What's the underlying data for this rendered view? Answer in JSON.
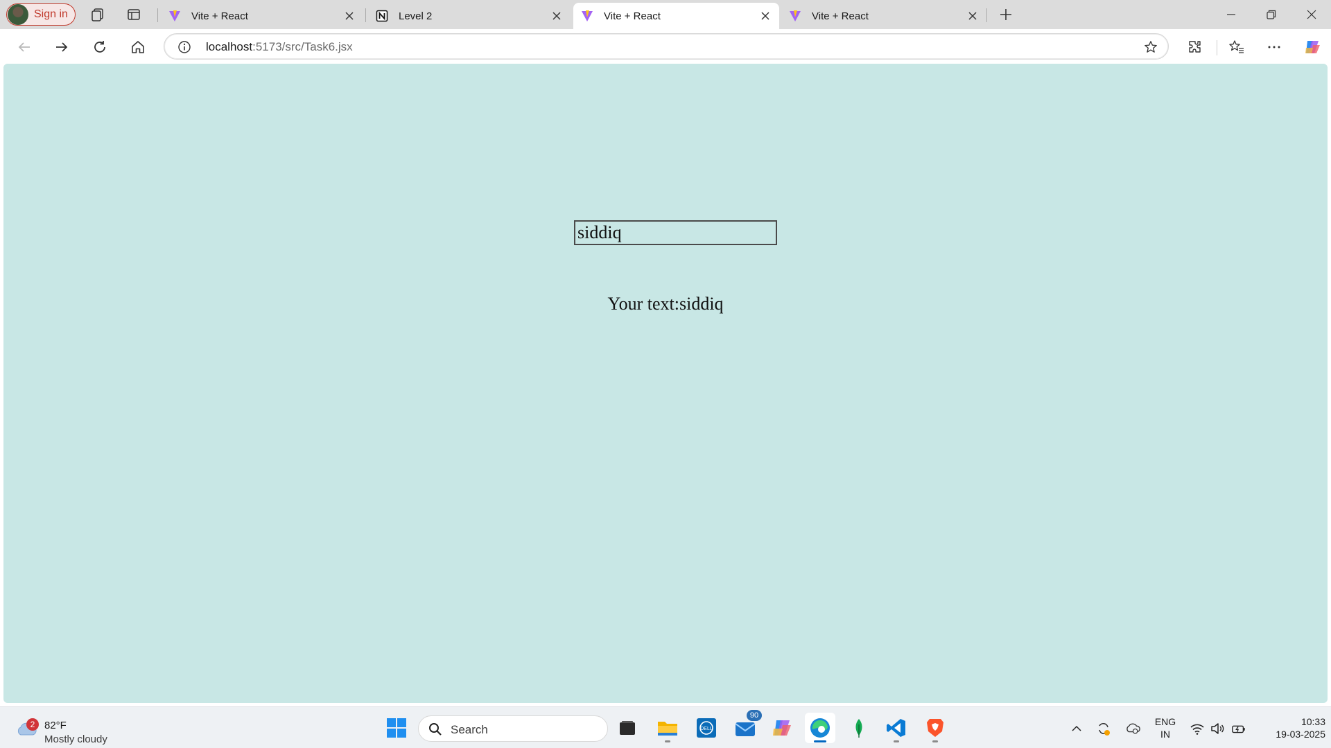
{
  "browser": {
    "signin_label": "Sign in",
    "tabs": [
      {
        "title": "Vite + React",
        "favicon": "vite-logo",
        "active": false
      },
      {
        "title": "Level 2",
        "favicon": "notion-logo",
        "active": false
      },
      {
        "title": "Vite + React",
        "favicon": "vite-logo",
        "active": true
      },
      {
        "title": "Vite + React",
        "favicon": "vite-logo",
        "active": false
      }
    ],
    "address": {
      "host": "localhost",
      "path": ":5173/src/Task6.jsx"
    }
  },
  "page": {
    "background": "#c8e7e5",
    "input_value": "siddiq",
    "echo_text": "Your text:siddiq"
  },
  "taskbar": {
    "weather": {
      "temperature": "82°F",
      "condition": "Mostly cloudy",
      "badge_count": "2"
    },
    "search_label": "Search",
    "mail_badge": "90",
    "apps": [
      "task-view",
      "file-explorer",
      "dell",
      "mail",
      "copilot",
      "edge",
      "mongodb-compass",
      "vscode",
      "brave"
    ],
    "language": {
      "line1": "ENG",
      "line2": "IN"
    },
    "clock": {
      "time": "10:33",
      "date": "19-03-2025"
    }
  },
  "colors": {
    "signin_accent": "#c0392b",
    "taskbar_accent": "#0067c0"
  }
}
